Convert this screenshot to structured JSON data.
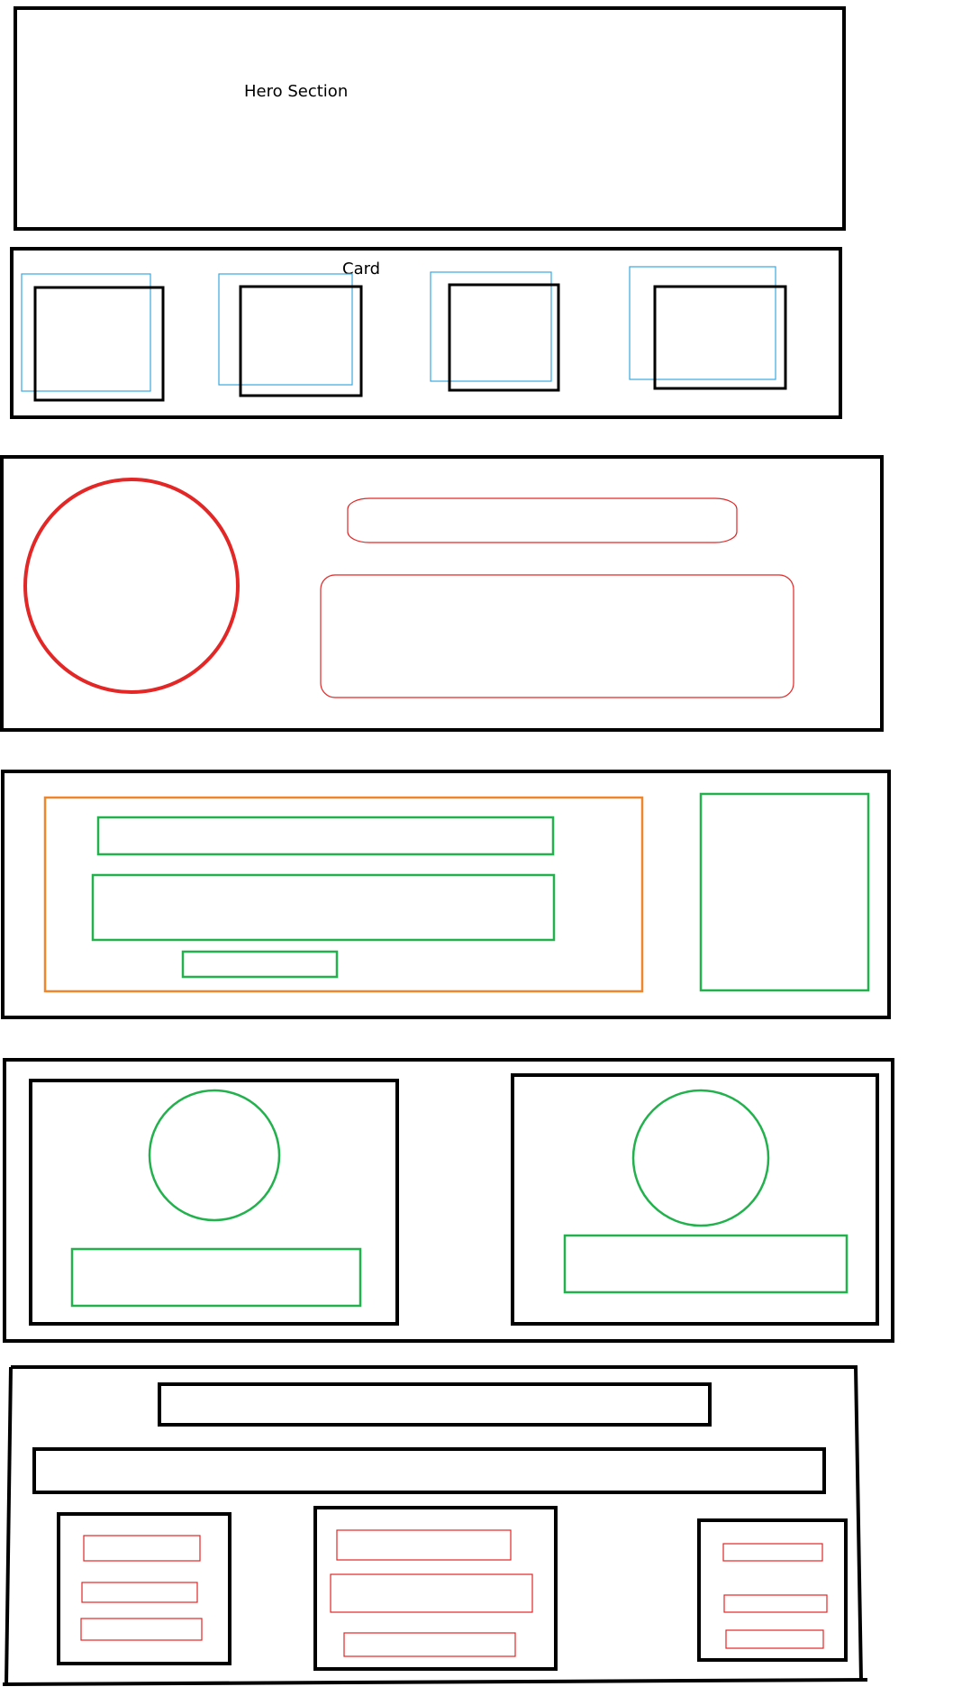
{
  "hero": {
    "label": "Hero Section"
  },
  "cards_section": {
    "label": "Card"
  },
  "colors": {
    "outline": "#000000",
    "card_overlay": "#3aa8e0",
    "profile": "#e32626",
    "form_fields": "#22b14c",
    "form_group": "#f0862b",
    "footer_items": "#e32626"
  }
}
